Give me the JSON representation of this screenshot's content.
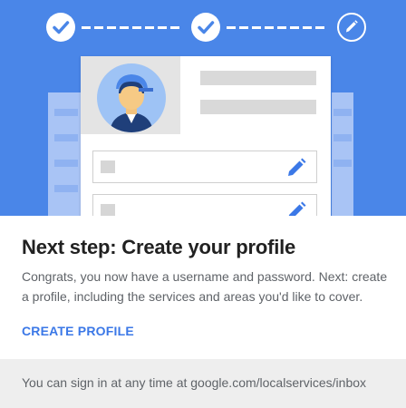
{
  "hero": {
    "progress": {
      "total_steps": 3,
      "completed_steps": 2,
      "current_step": 3
    },
    "icons": [
      "check-icon",
      "check-icon",
      "pencil-icon",
      "pencil-icon",
      "pencil-icon"
    ],
    "colors": {
      "hero_bg": "#4a86e8",
      "accent": "#3b78e7",
      "avatar_bg": "#9ec3f5"
    }
  },
  "content": {
    "title": "Next step: Create your profile",
    "body": "Congrats, you now have a username and password. Next: create a profile, including the services and areas you'd like to cover.",
    "cta_label": "CREATE PROFILE"
  },
  "footer": {
    "text": "You can sign in at any time at google.com/localservices/inbox"
  }
}
